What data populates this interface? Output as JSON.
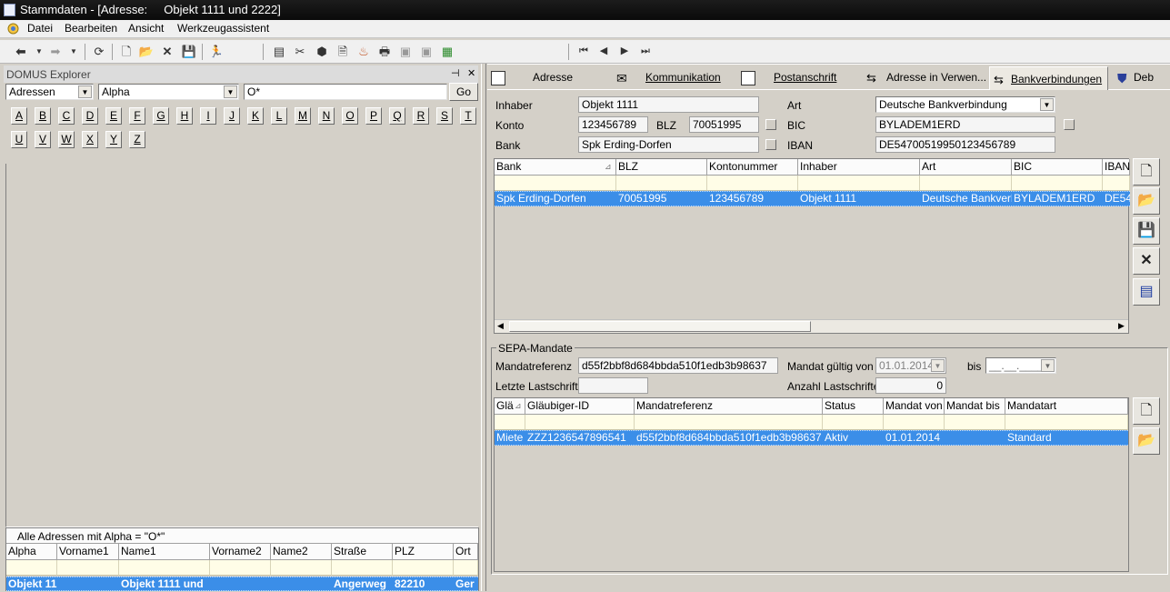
{
  "window": {
    "title": "Stammdaten - [Adresse:     Objekt 1111 und 2222]"
  },
  "menu": {
    "items": [
      "Datei",
      "Bearbeiten",
      "Ansicht",
      "Werkzeugassistent"
    ]
  },
  "explorer": {
    "title": "DOMUS Explorer",
    "pin": "⊣",
    "close": "✕",
    "type_select": "Adressen",
    "sort_select": "Alpha",
    "search_value": "O*",
    "go_label": "Go",
    "letters": [
      "A",
      "B",
      "C",
      "D",
      "E",
      "F",
      "G",
      "H",
      "I",
      "J",
      "K",
      "L",
      "M",
      "N",
      "O",
      "P",
      "Q",
      "R",
      "S",
      "T",
      "U",
      "V",
      "W",
      "X",
      "Y",
      "Z"
    ],
    "result_caption": "Alle Adressen mit Alpha = \"O*\"",
    "columns": [
      "Alpha",
      "Vorname1",
      "Name1",
      "Vorname2",
      "Name2",
      "Straße",
      "PLZ",
      "Ort"
    ],
    "row": [
      "Objekt 11",
      "",
      "Objekt 1111 und",
      "",
      "",
      "Angerweg",
      "82210",
      "Ger"
    ]
  },
  "tabs": [
    "Adresse",
    "Kommunikation",
    "Postanschrift",
    "Adresse in Verwen...",
    "Bankverbindungen",
    "Deb"
  ],
  "form": {
    "inhaber_label": "Inhaber",
    "inhaber_value": "Objekt 1111",
    "art_label": "Art",
    "art_value": "Deutsche Bankverbindung",
    "konto_label": "Konto",
    "konto_value": "123456789",
    "blz_label": "BLZ",
    "blz_value": "70051995",
    "bic_label": "BIC",
    "bic_value": "BYLADEM1ERD",
    "bank_label": "Bank",
    "bank_value": "Spk Erding-Dorfen",
    "iban_label": "IBAN",
    "iban_value": "DE54700519950123456789"
  },
  "bank_grid": {
    "columns": [
      "Bank",
      "BLZ",
      "Kontonummer",
      "Inhaber",
      "Art",
      "BIC",
      "IBAN"
    ],
    "row": [
      "Spk Erding-Dorfen",
      "70051995",
      "123456789",
      "Objekt 1111",
      "Deutsche Bankverb",
      "BYLADEM1ERD",
      "DE54"
    ]
  },
  "sepa": {
    "group_label": "SEPA-Mandate",
    "mandatref_label": "Mandatreferenz",
    "mandatref_value": "d55f2bbf8d684bbda510f1edb3b98637",
    "gueltig_label": "Mandat gültig von",
    "gueltig_value": "01.01.2014",
    "bis_label": "bis",
    "bis_value": "__.__.____",
    "letzte_label": "Letzte Lastschrift",
    "letzte_value": "",
    "anzahl_label": "Anzahl Lastschriften",
    "anzahl_value": "0",
    "columns": [
      "Glä",
      "Gläubiger-ID",
      "Mandatreferenz",
      "Status",
      "Mandat von",
      "Mandat bis",
      "Mandatart"
    ],
    "row": [
      "Miete",
      "ZZZ1236547896541",
      "d55f2bbf8d684bbda510f1edb3b98637",
      "Aktiv",
      "01.01.2014",
      "",
      "Standard"
    ]
  },
  "colors": {
    "selection": "#3b8ee8",
    "titlebar": "#111111",
    "filter_row": "#fffde7"
  }
}
